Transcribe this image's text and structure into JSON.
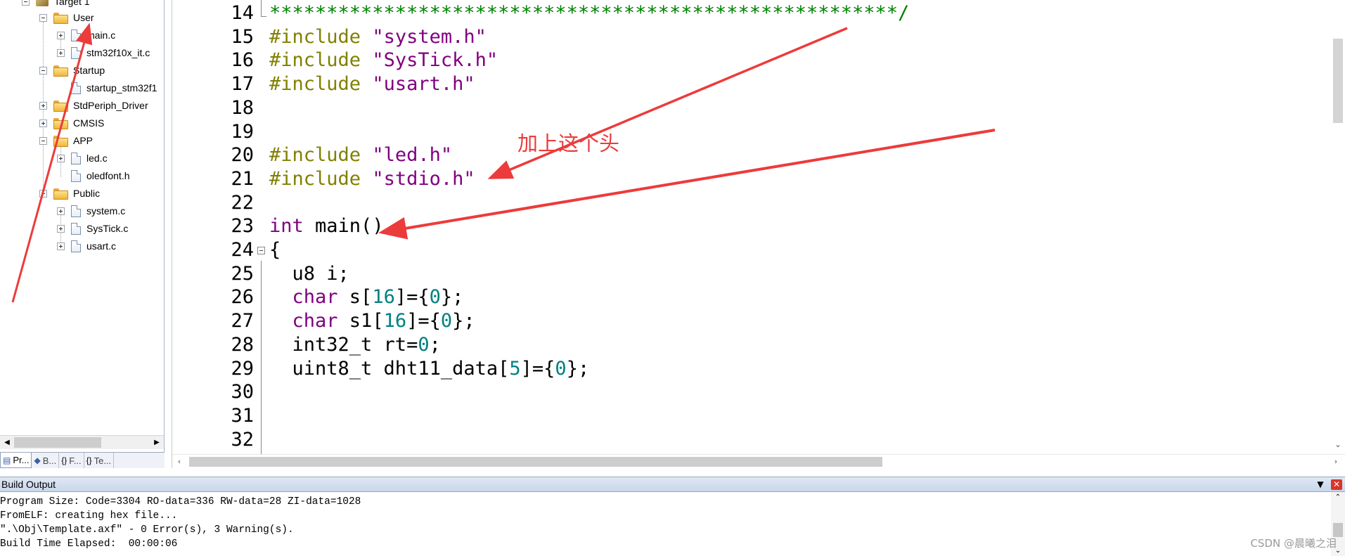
{
  "project_tree": {
    "items": [
      {
        "label": "Target 1",
        "kind": "project"
      },
      {
        "label": "User",
        "kind": "folder"
      },
      {
        "label": "main.c",
        "kind": "file"
      },
      {
        "label": "stm32f10x_it.c",
        "kind": "file"
      },
      {
        "label": "Startup",
        "kind": "folder"
      },
      {
        "label": "startup_stm32f1",
        "kind": "file"
      },
      {
        "label": "StdPeriph_Driver",
        "kind": "folder"
      },
      {
        "label": "CMSIS",
        "kind": "folder"
      },
      {
        "label": "APP",
        "kind": "folder"
      },
      {
        "label": "led.c",
        "kind": "file"
      },
      {
        "label": "oledfont.h",
        "kind": "file"
      },
      {
        "label": "Public",
        "kind": "folder"
      },
      {
        "label": "system.c",
        "kind": "file"
      },
      {
        "label": "SysTick.c",
        "kind": "file"
      },
      {
        "label": "usart.c",
        "kind": "file"
      }
    ],
    "tabs": [
      {
        "label": "Pr...",
        "icon": "project-tab-icon"
      },
      {
        "label": "B...",
        "icon": "books-tab-icon"
      },
      {
        "label": "F...",
        "icon": "functions-tab-icon"
      },
      {
        "label": "Te...",
        "icon": "templates-tab-icon"
      }
    ]
  },
  "editor": {
    "lines": [
      {
        "no": "14",
        "tokens": [
          {
            "t": "*******************************************************/",
            "c": "comment"
          }
        ]
      },
      {
        "no": "15",
        "tokens": [
          {
            "t": "#include ",
            "c": "pre"
          },
          {
            "t": "\"system.h\"",
            "c": "str"
          }
        ]
      },
      {
        "no": "16",
        "tokens": [
          {
            "t": "#include ",
            "c": "pre"
          },
          {
            "t": "\"SysTick.h\"",
            "c": "str"
          }
        ]
      },
      {
        "no": "17",
        "tokens": [
          {
            "t": "#include ",
            "c": "pre"
          },
          {
            "t": "\"usart.h\"",
            "c": "str"
          }
        ]
      },
      {
        "no": "18",
        "tokens": []
      },
      {
        "no": "19",
        "tokens": []
      },
      {
        "no": "20",
        "tokens": [
          {
            "t": "#include ",
            "c": "pre"
          },
          {
            "t": "\"led.h\"",
            "c": "str"
          }
        ]
      },
      {
        "no": "21",
        "tokens": [
          {
            "t": "#include ",
            "c": "pre"
          },
          {
            "t": "\"stdio.h\"",
            "c": "str"
          }
        ]
      },
      {
        "no": "22",
        "tokens": []
      },
      {
        "no": "23",
        "tokens": [
          {
            "t": "int",
            "c": "kw"
          },
          {
            "t": " main()",
            "c": "plain"
          }
        ]
      },
      {
        "no": "24",
        "tokens": [
          {
            "t": "{",
            "c": "plain"
          }
        ]
      },
      {
        "no": "25",
        "tokens": [
          {
            "t": "  u8 i;",
            "c": "plain"
          }
        ]
      },
      {
        "no": "26",
        "tokens": [
          {
            "t": "  ",
            "c": "plain"
          },
          {
            "t": "char",
            "c": "kw"
          },
          {
            "t": " s[",
            "c": "plain"
          },
          {
            "t": "16",
            "c": "num"
          },
          {
            "t": "]={",
            "c": "plain"
          },
          {
            "t": "0",
            "c": "num"
          },
          {
            "t": "};",
            "c": "plain"
          }
        ]
      },
      {
        "no": "27",
        "tokens": [
          {
            "t": "  ",
            "c": "plain"
          },
          {
            "t": "char",
            "c": "kw"
          },
          {
            "t": " s1[",
            "c": "plain"
          },
          {
            "t": "16",
            "c": "num"
          },
          {
            "t": "]={",
            "c": "plain"
          },
          {
            "t": "0",
            "c": "num"
          },
          {
            "t": "};",
            "c": "plain"
          }
        ]
      },
      {
        "no": "28",
        "tokens": [
          {
            "t": "  int32_t rt=",
            "c": "plain"
          },
          {
            "t": "0",
            "c": "num"
          },
          {
            "t": ";",
            "c": "plain"
          }
        ]
      },
      {
        "no": "29",
        "tokens": [
          {
            "t": "  uint8_t dht11_data[",
            "c": "plain"
          },
          {
            "t": "5",
            "c": "num"
          },
          {
            "t": "]={",
            "c": "plain"
          },
          {
            "t": "0",
            "c": "num"
          },
          {
            "t": "};",
            "c": "plain"
          }
        ]
      },
      {
        "no": "30",
        "tokens": []
      },
      {
        "no": "31",
        "tokens": []
      },
      {
        "no": "32",
        "tokens": []
      }
    ],
    "colors": {
      "comment": "#008000",
      "preprocessor": "#808000",
      "string": "#800080",
      "keyword": "#800080",
      "number": "#008080"
    }
  },
  "annotation": {
    "note": "加上这个头",
    "color": "#ec3b3b"
  },
  "build_output": {
    "title": "Build Output",
    "lines": [
      "Program Size: Code=3304 RO-data=336 RW-data=28 ZI-data=1028",
      "FromELF: creating hex file...",
      "\".\\Obj\\Template.axf\" - 0 Error(s), 3 Warning(s).",
      "Build Time Elapsed:  00:00:06"
    ],
    "pin_icon": "pin-icon",
    "close_icon": "close-icon"
  },
  "watermark": "CSDN @晨曦之泪"
}
